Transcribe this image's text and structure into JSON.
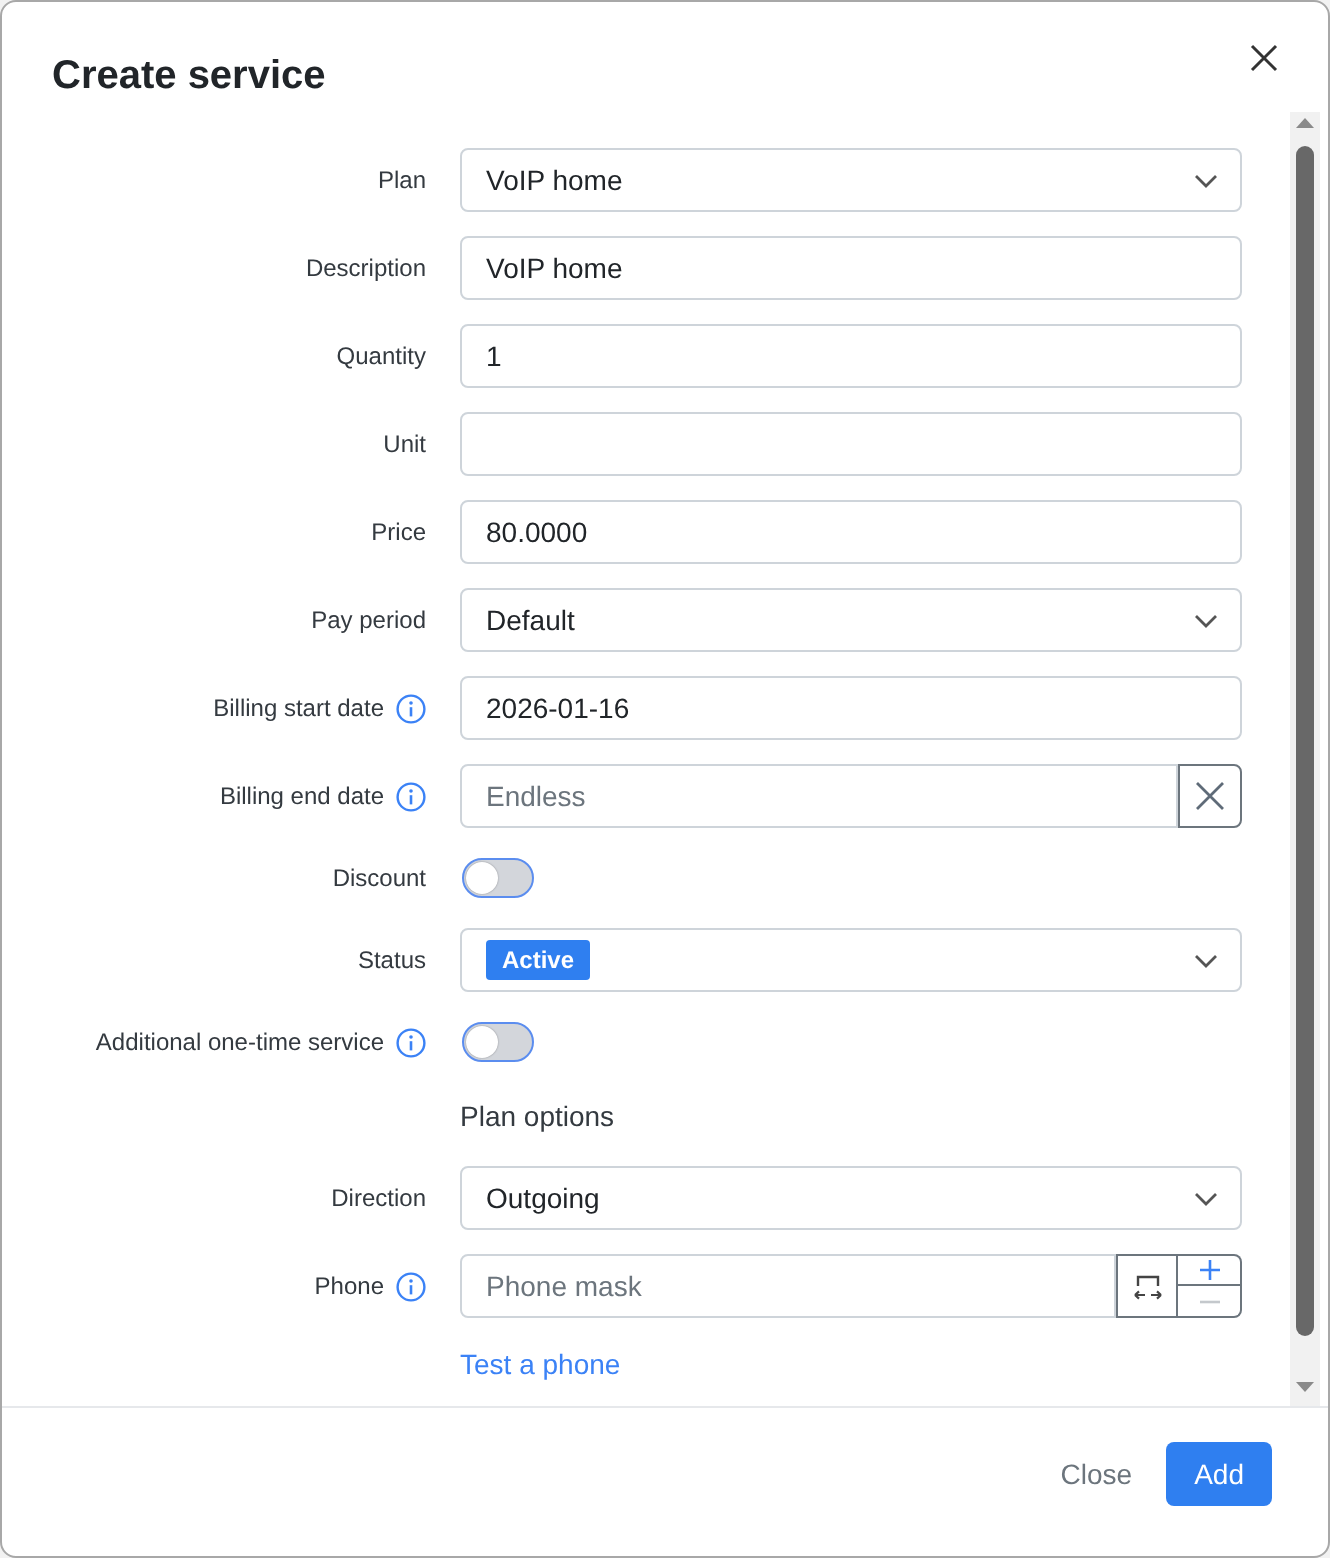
{
  "dialog": {
    "title": "Create service"
  },
  "fields": [
    {
      "kind": "select",
      "label": "Plan",
      "info": false,
      "value": "VoIP home"
    },
    {
      "kind": "text",
      "label": "Description",
      "info": false,
      "value": "VoIP home"
    },
    {
      "kind": "text",
      "label": "Quantity",
      "info": false,
      "value": "1"
    },
    {
      "kind": "text",
      "label": "Unit",
      "info": false
    },
    {
      "kind": "text",
      "label": "Price",
      "info": false,
      "value": "80.0000"
    },
    {
      "kind": "select",
      "label": "Pay period",
      "info": false,
      "value": "Default"
    },
    {
      "kind": "text",
      "label": "Billing start date",
      "info": true,
      "value": "2026-01-16"
    },
    {
      "kind": "clearable",
      "label": "Billing end date",
      "info": true,
      "placeholder": "Endless"
    },
    {
      "kind": "toggle",
      "label": "Discount",
      "info": false,
      "on": false
    },
    {
      "kind": "badge_select",
      "label": "Status",
      "info": false,
      "value": "Active"
    },
    {
      "kind": "toggle",
      "label": "Additional one-time service",
      "info": true,
      "on": false
    },
    {
      "kind": "heading",
      "text": "Plan options"
    },
    {
      "kind": "select",
      "label": "Direction",
      "info": false,
      "value": "Outgoing"
    },
    {
      "kind": "phone",
      "label": "Phone",
      "info": true,
      "placeholder": "Phone mask",
      "steppers": [
        {
          "kind": "plus",
          "disabled": false
        },
        {
          "kind": "minus",
          "disabled": true
        }
      ]
    },
    {
      "kind": "link",
      "text": "Test a phone"
    }
  ],
  "footer": {
    "buttons": [
      {
        "kind": "secondary",
        "label": "Close"
      },
      {
        "kind": "primary",
        "label": "Add"
      }
    ]
  }
}
